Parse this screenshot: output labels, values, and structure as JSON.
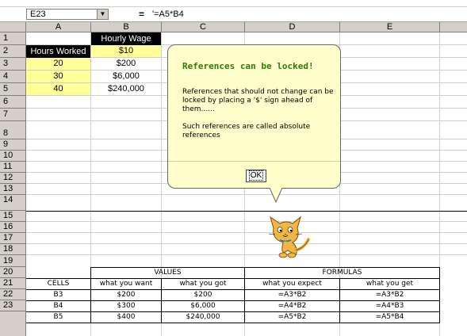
{
  "formula_bar": {
    "name_box": "E23",
    "dropdown_glyph": "▼",
    "equals": "=",
    "formula": "'=A5*B4"
  },
  "columns": [
    "A",
    "B",
    "C",
    "D",
    "E"
  ],
  "rows": [
    "1",
    "2",
    "3",
    "4",
    "5",
    "6",
    "7",
    "8",
    "9",
    "10",
    "11",
    "12",
    "13",
    "14",
    "15",
    "16",
    "17",
    "18",
    "19",
    "20",
    "21",
    "22",
    "23"
  ],
  "sheet": {
    "b1": "Hourly Wage",
    "a2": "Hours Worked",
    "b2": "$10",
    "a3": "20",
    "b3": "$200",
    "a4": "30",
    "b4": "$6,000",
    "a5": "40",
    "b5": "$240,000"
  },
  "comparison": {
    "values_header": "VALUES",
    "formulas_header": "FORMULAS",
    "cols": [
      "CELLS",
      "what you want",
      "what you got",
      "what you expect",
      "what you get"
    ],
    "rows": [
      [
        "B3",
        "$200",
        "$200",
        "=A3*B2",
        "=A3*B2"
      ],
      [
        "B4",
        "$300",
        "$6,000",
        "=A4*B2",
        "=A4*B3"
      ],
      [
        "B5",
        "$400",
        "$240,000",
        "=A5*B2",
        "=A5*B4"
      ]
    ]
  },
  "assistant": {
    "title": "References can be locked!",
    "para1": "References that should not change can be locked by placing a '$' sign ahead of them......",
    "para2": "Such references are called absolute references",
    "ok_label": "OK"
  },
  "colors": {
    "yellow_cell": "#ffff99",
    "bubble": "#ffffcc",
    "title_green": "#2e7d00"
  }
}
